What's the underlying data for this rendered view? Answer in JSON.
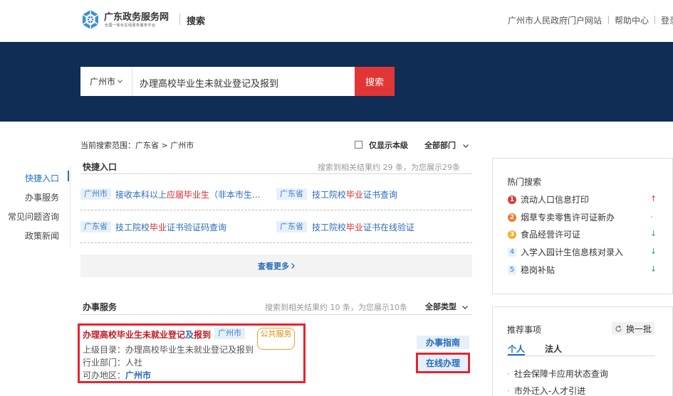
{
  "header": {
    "brand_title": "广东政务服务网",
    "brand_subtitle": "全国一体化在线政务服务平台",
    "page_label": "搜索",
    "links": [
      "广州市人民政府门户网站",
      "帮助中心",
      "登录"
    ]
  },
  "search": {
    "city": "广州市",
    "query": "办理高校毕业生未就业登记及报到",
    "button": "搜索"
  },
  "filters": {
    "scope": "当前搜索范围：广东省 > 广州市",
    "only_this_level": "仅显示本级",
    "department": "全部部门"
  },
  "side_nav": {
    "items": [
      "快捷入口",
      "办事服务",
      "常见问题咨询",
      "政策新闻"
    ],
    "active_index": 0
  },
  "quick_entry": {
    "title": "快捷入口",
    "result_info": "搜索到相关结果约 29 条，为您展示29条",
    "items": [
      {
        "tag": "广州市",
        "pre": "接收本科以上",
        "hl": "应届毕业生",
        "post": "（非本市生..."
      },
      {
        "tag": "广东省",
        "pre": "技工院校",
        "hl": "毕业",
        "post": "证书查询"
      },
      {
        "tag": "广东省",
        "pre": "技工院校",
        "hl": "毕业",
        "post": "证书验证码查询"
      },
      {
        "tag": "广东省",
        "pre": "技工院校",
        "hl": "毕业",
        "post": "证书在线验证"
      }
    ],
    "more": "查看更多"
  },
  "services": {
    "title": "办事服务",
    "result_info": "搜索到相关结果约 10 条，为您展示10条",
    "type_filter": "全部类型",
    "item": {
      "title_a": "办理高校毕业生未就业登记",
      "title_b": "及",
      "title_c": "报到",
      "tag_city": "广州市",
      "tag_type": "公共服务",
      "catalog_label": "上级目录：",
      "catalog": "办理高校毕业生未就业登记及报到",
      "dept_label": "行业部门：",
      "dept": "人社",
      "region_label": "可办地区：",
      "region": "广州市",
      "guide_btn": "办事指南",
      "online_btn": "在线办理"
    }
  },
  "hot_search": {
    "title": "热门搜索",
    "items": [
      {
        "n": "1",
        "text": "流动人口信息打印",
        "trend": "↑",
        "trend_color": "#e23636",
        "badge_color": "#e23636"
      },
      {
        "n": "2",
        "text": "烟草专卖零售许可证新办",
        "trend": "-",
        "trend_color": "#f0a02a",
        "badge_color": "#f07a2a"
      },
      {
        "n": "3",
        "text": "食品经营许可证",
        "trend": "↓",
        "trend_color": "#2ea84a",
        "badge_color": "#f0b02a"
      },
      {
        "n": "4",
        "text": "入学入园计生信息核对录入",
        "trend": "↓",
        "trend_color": "#2ea84a",
        "badge_color": ""
      },
      {
        "n": "5",
        "text": "稳岗补贴",
        "trend": "↓",
        "trend_color": "#2ea84a",
        "badge_color": ""
      }
    ]
  },
  "recommend": {
    "title": "推荐事项",
    "swap": "换一批",
    "tabs": [
      "个人",
      "法人"
    ],
    "items": [
      "社会保障卡应用状态查询",
      "市外迁入-人才引进"
    ]
  },
  "colors": {
    "banner": "#0f2d55",
    "accent": "#e23636",
    "link": "#2a6cb8"
  }
}
